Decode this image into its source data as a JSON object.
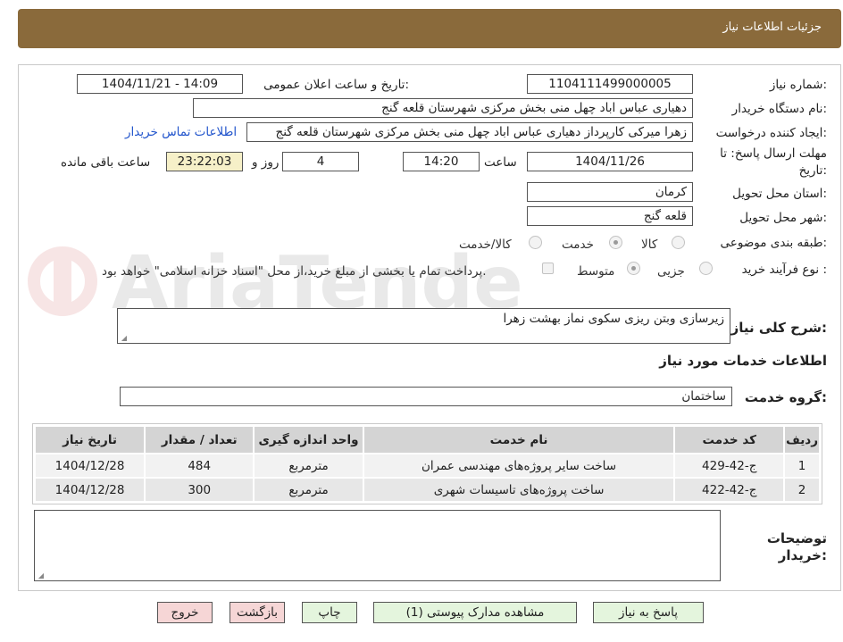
{
  "header": {
    "title": "جزئیات اطلاعات نیاز"
  },
  "watermark_text": "AriaTender.neT",
  "fields": {
    "need_number": {
      "label": "شماره نیاز:",
      "value": "1104111499000005"
    },
    "announce_datetime": {
      "label": "تاریخ و ساعت اعلان عمومی:",
      "value": "1404/11/21 - 14:09"
    },
    "buyer_org": {
      "label": "نام دستگاه خریدار:",
      "value": "دهیاری عباس اباد چهل منی بخش مرکزی شهرستان قلعه گنج"
    },
    "requester": {
      "label": "ایجاد کننده درخواست:",
      "value": "زهرا میرکی کارپرداز دهیاری عباس اباد چهل منی بخش مرکزی شهرستان قلعه گنج"
    },
    "buyer_contact_link": "اطلاعات تماس خریدار",
    "deadline": {
      "label_line1": "مهلت ارسال پاسخ: تا",
      "label_line2": "تاریخ:",
      "date": "1404/11/26",
      "time_label": "ساعت",
      "time": "14:20",
      "days": "4",
      "days_label": "روز و",
      "remaining": "23:22:03",
      "remaining_label": "ساعت باقی مانده"
    },
    "province": {
      "label": "استان محل تحویل:",
      "value": "کرمان"
    },
    "city": {
      "label": "شهر محل تحویل:",
      "value": "قلعه گنج"
    },
    "category": {
      "label": "طبقه بندی موضوعی:",
      "options": [
        "کالا",
        "خدمت",
        "کالا/خدمت"
      ],
      "selected": "خدمت"
    },
    "purchase_process": {
      "label": "نوع فرآیند خرید :",
      "options": [
        "جزیی",
        "متوسط"
      ],
      "selected": "متوسط",
      "payment_note": "پرداخت تمام یا بخشی از مبلغ خرید،از محل \"اسناد خزانه اسلامی\" خواهد بود."
    }
  },
  "general_description": {
    "label": "شرح کلی نیاز:",
    "value": "زیرسازی وبتن ریزی سکوی نماز بهشت زهرا"
  },
  "services_section": {
    "title": "اطلاعات خدمات مورد نیاز",
    "group_label": "گروه خدمت:",
    "group_value": "ساختمان"
  },
  "table": {
    "headers": [
      "ردیف",
      "کد خدمت",
      "نام خدمت",
      "واحد اندازه گیری",
      "تعداد / مقدار",
      "تاریخ نیاز"
    ],
    "rows": [
      [
        "1",
        "ج-42-429",
        "ساخت سایر پروژه‌های مهندسی عمران",
        "مترمربع",
        "484",
        "1404/12/28"
      ],
      [
        "2",
        "ج-42-422",
        "ساخت پروژه‌های تاسیسات شهری",
        "مترمربع",
        "300",
        "1404/12/28"
      ]
    ]
  },
  "buyer_notes": {
    "label_line1": "توضیحات",
    "label_line2": "خریدار:",
    "value": ""
  },
  "buttons": {
    "reply": "پاسخ به نیاز",
    "attachments": "مشاهده مدارک پیوستی (1)",
    "print": "چاپ",
    "back": "بازگشت",
    "exit": "خروج"
  },
  "colors": {
    "header_bg": "#8a6a3b",
    "button_green": "#e4f5dd",
    "button_pink": "#f6d6d6",
    "remaining_bg": "#f6f0c8",
    "link": "#2255cc"
  }
}
